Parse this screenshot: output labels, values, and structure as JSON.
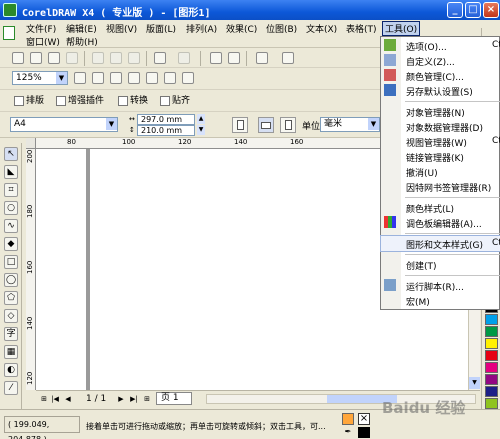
{
  "window": {
    "title": "CorelDRAW X4 ( 专业版 ) - [图形1]",
    "controls": {
      "minimize": "_",
      "maximize": "□",
      "close": "×"
    }
  },
  "menu": {
    "row1": [
      {
        "label": "文件(F)"
      },
      {
        "label": "编辑(E)"
      },
      {
        "label": "视图(V)"
      },
      {
        "label": "版面(L)"
      },
      {
        "label": "排列(A)"
      },
      {
        "label": "效果(C)"
      },
      {
        "label": "位图(B)"
      },
      {
        "label": "文本(X)"
      },
      {
        "label": "表格(T)"
      }
    ],
    "tools_active": "工具(O)",
    "row2": [
      {
        "label": "窗口(W)"
      },
      {
        "label": "帮助(H)"
      }
    ]
  },
  "zoom": {
    "value": "125%"
  },
  "toolbar3": {
    "typeset": "排版",
    "plugins": "增强插件",
    "convert": "转换",
    "sticker": "贴齐"
  },
  "property_bar": {
    "paper": "A4",
    "width": "297.0 mm",
    "height": "210.0 mm",
    "unit_label": "单位:",
    "unit_value": "毫米"
  },
  "rulers": {
    "top": [
      "80",
      "100",
      "120",
      "140",
      "160"
    ],
    "left": [
      "200",
      "180",
      "160",
      "140",
      "120"
    ]
  },
  "navigation": {
    "page_count": "1 / 1",
    "page_tab": "页 1"
  },
  "status": {
    "coords": "( 199.049, 204.878 )",
    "hint": "接着单击可进行拖动或缩放；再单击可旋转或倾斜；双击工具，可..."
  },
  "watermark": "Baidu 经验",
  "palette_colors": [
    "#ffffff",
    "#000000",
    "#00a0e9",
    "#009944",
    "#fff100",
    "#e60012",
    "#e4007f",
    "#920783",
    "#1d2088",
    "#8fc31f",
    "#f39800"
  ],
  "tools_menu": {
    "items": [
      {
        "label": "选项(O)...",
        "shortcut": "Ct",
        "icon": "options-icon"
      },
      {
        "label": "自定义(Z)...",
        "shortcut": "",
        "icon": "customize-icon"
      },
      {
        "label": "颜色管理(C)...",
        "shortcut": "",
        "icon": "color-management-icon"
      },
      {
        "label": "另存默认设置(S)",
        "shortcut": "",
        "icon": "save-defaults-icon"
      },
      {
        "label": "对象管理器(N)",
        "shortcut": "",
        "icon": ""
      },
      {
        "label": "对象数据管理器(D)",
        "shortcut": "",
        "icon": ""
      },
      {
        "label": "视图管理器(W)",
        "shortcut": "Ct",
        "icon": ""
      },
      {
        "label": "链接管理器(K)",
        "shortcut": "",
        "icon": ""
      },
      {
        "label": "撤消(U)",
        "shortcut": "",
        "icon": ""
      },
      {
        "label": "因特网书签管理器(R)",
        "shortcut": "",
        "icon": ""
      },
      {
        "label": "颜色样式(L)",
        "shortcut": "",
        "icon": ""
      },
      {
        "label": "调色板编辑器(A)...",
        "shortcut": "",
        "icon": "palette-editor-icon"
      },
      {
        "label": "图形和文本样式(G)",
        "shortcut": "Ct",
        "icon": ""
      },
      {
        "label": "创建(T)",
        "shortcut": "",
        "icon": ""
      },
      {
        "label": "运行脚本(R)...",
        "shortcut": "",
        "icon": "run-script-icon"
      },
      {
        "label": "宏(M)",
        "shortcut": "",
        "icon": ""
      }
    ]
  }
}
